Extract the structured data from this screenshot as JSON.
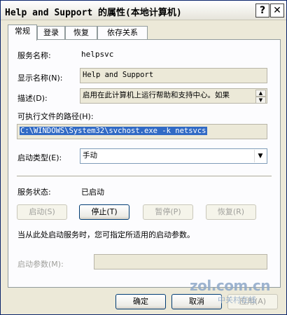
{
  "window": {
    "title": "Help and Support 的属性(本地计算机)",
    "help_glyph": "?",
    "close_glyph": "✕"
  },
  "tabs": [
    {
      "label": "常规",
      "active": true
    },
    {
      "label": "登录",
      "active": false
    },
    {
      "label": "恢复",
      "active": false
    },
    {
      "label": "依存关系",
      "active": false
    }
  ],
  "general": {
    "service_name_label": "服务名称:",
    "service_name_value": "helpsvc",
    "display_name_label": "显示名称(N):",
    "display_name_value": "Help and Support",
    "description_label": "描述(D):",
    "description_value": "启用在此计算机上运行帮助和支持中心。如果",
    "path_label": "可执行文件的路径(H):",
    "path_value": "C:\\WINDOWS\\System32\\svchost.exe -k netsvcs",
    "startup_type_label": "启动类型(E):",
    "startup_type_value": "手动",
    "status_label": "服务状态:",
    "status_value": "已启动",
    "start_button": "启动(S)",
    "stop_button": "停止(T)",
    "pause_button": "暂停(P)",
    "resume_button": "恢复(R)",
    "hint_text": "当从此处启动服务时，您可指定所适用的启动参数。",
    "start_params_label": "启动参数(M):",
    "start_params_value": ""
  },
  "footer": {
    "ok_button": "确定",
    "cancel_button": "取消",
    "apply_button": "应用(A)"
  },
  "watermark": {
    "site": "zol.com.cn",
    "name": "中关村在线"
  }
}
